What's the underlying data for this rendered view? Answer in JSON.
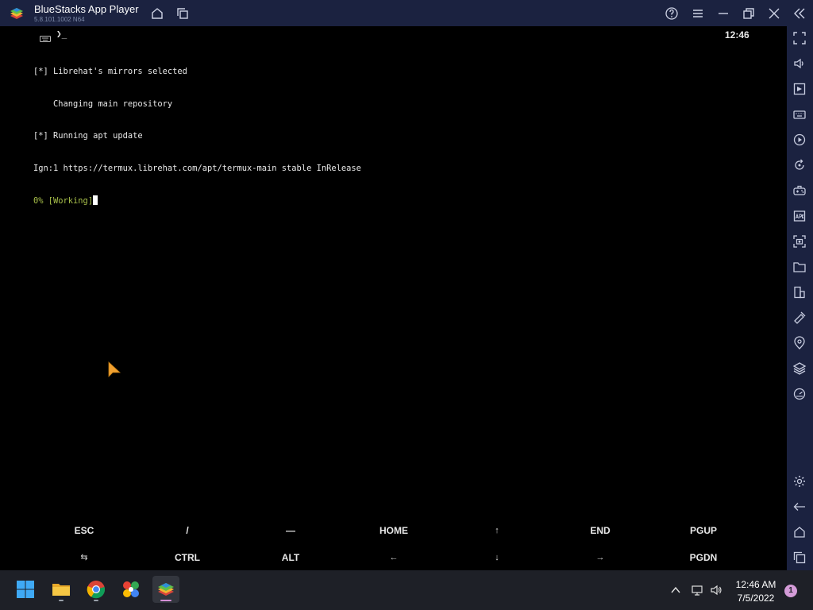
{
  "window": {
    "title": "BlueStacks App Player",
    "version": "5.8.101.1002 N64"
  },
  "titlebar_icons": [
    "home-icon",
    "multi-instance-icon",
    "help-icon",
    "menu-icon",
    "minimize-icon",
    "restore-icon",
    "close-icon",
    "collapse-sidebar-icon"
  ],
  "statusbar": {
    "prompt_glyph": "❯_",
    "time": "12:46"
  },
  "terminal": {
    "lines": [
      "[*] Librehat's mirrors selected",
      "    Changing main repository",
      "[*] Running apt update",
      "Ign:1 https://termux.librehat.com/apt/termux-main stable InRelease"
    ],
    "progress_line": "0% [Working]"
  },
  "extra_keys": {
    "row1": [
      "ESC",
      "/",
      "—",
      "HOME",
      "↑",
      "END",
      "PGUP"
    ],
    "row2": [
      "⇆",
      "CTRL",
      "ALT",
      "←",
      "↓",
      "→",
      "PGDN"
    ]
  },
  "sidebar_icons": [
    "fullscreen-icon",
    "volume-icon",
    "media-manager-icon",
    "keyboard-icon",
    "macro-record-icon",
    "rotate-icon",
    "gamepad-icon",
    "install-apk-icon",
    "screenshot-icon",
    "folder-icon",
    "multi-instance-icon",
    "eco-mode-icon",
    "location-icon",
    "layers-icon",
    "performance-icon",
    "settings-icon",
    "back-icon",
    "android-home-icon",
    "recent-apps-icon"
  ],
  "taskbar": {
    "apps": [
      "windows-start-icon",
      "file-explorer-icon",
      "chrome-icon",
      "photos-icon",
      "bluestacks-icon"
    ],
    "active_app": "bluestacks-icon",
    "clock_time": "12:46 AM",
    "clock_date": "7/5/2022",
    "notification_count": "1"
  },
  "colors": {
    "chrome_bg": "#1b2240",
    "terminal_bg": "#000000",
    "terminal_text": "#e8e8e8",
    "progress_green": "#a8c04a",
    "taskbar_bg": "#1e2027",
    "pointer_orange": "#f0a030"
  }
}
